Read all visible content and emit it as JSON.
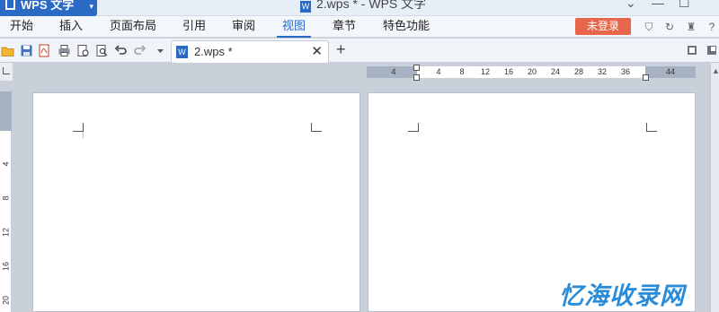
{
  "app": {
    "name": "WPS 文字",
    "dropdown": "▾"
  },
  "window": {
    "title": "2.wps * - WPS 文字",
    "icon_letter": "W",
    "controls": [
      "⌄",
      "—",
      "☐"
    ]
  },
  "menu": {
    "tabs": [
      "开始",
      "插入",
      "页面布局",
      "引用",
      "审阅",
      "视图",
      "章节",
      "特色功能"
    ],
    "active": "视图",
    "login": "未登录",
    "right_icons": [
      "⛉",
      "↻",
      "♜",
      "?"
    ]
  },
  "toolbar": {
    "icons": [
      "open-icon",
      "save-icon",
      "export-pdf-icon",
      "print-icon",
      "print-preview-icon",
      "find-icon",
      "undo-icon",
      "redo-icon",
      "more-icon"
    ],
    "doc_tab": {
      "name": "2.wps *",
      "close": "✕",
      "icon_letter": "W"
    },
    "new_tab": "+"
  },
  "ruler": {
    "horizontal": [
      "4",
      "4",
      "8",
      "12",
      "16",
      "20",
      "24",
      "28",
      "32",
      "36",
      "44"
    ],
    "vertical": [
      "4",
      "8",
      "12",
      "16",
      "20"
    ]
  },
  "watermark": "忆海收录网",
  "colors": {
    "accent": "#2a69c4",
    "login": "#e8664b",
    "watermark": "#2a8cd8"
  }
}
